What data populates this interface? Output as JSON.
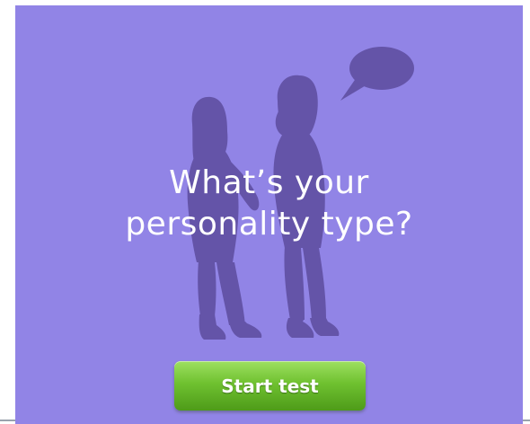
{
  "headline": {
    "line1": "What’s your",
    "line2": "personality type?"
  },
  "start_button": {
    "label": "Start test"
  },
  "colors": {
    "background": "#9184e6",
    "silhouette": "#6454a8",
    "button_top": "#9ee061",
    "button_bottom": "#4e9b19",
    "text": "#ffffff"
  },
  "illustration": {
    "description_icon": "two-women-silhouette-icon",
    "bubble_icon": "speech-bubble-icon"
  }
}
